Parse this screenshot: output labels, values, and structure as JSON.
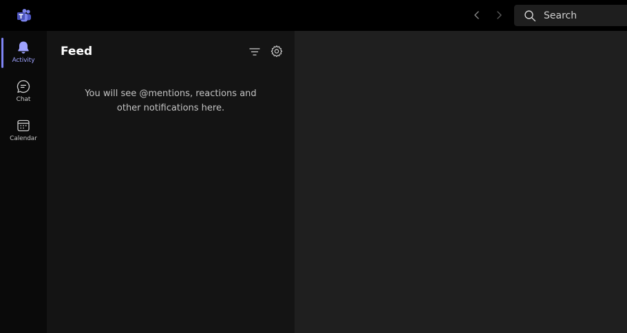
{
  "titlebar": {
    "search": {
      "placeholder": "Search"
    }
  },
  "rail": {
    "items": [
      {
        "label": "Activity",
        "icon": "bell-icon",
        "active": true
      },
      {
        "label": "Chat",
        "icon": "chat-icon",
        "active": false
      },
      {
        "label": "Calendar",
        "icon": "calendar-icon",
        "active": false
      }
    ]
  },
  "feed": {
    "title": "Feed",
    "empty_message": "You will see @mentions, reactions and other notifications here."
  },
  "colors": {
    "accent": "#7f85f5",
    "titlebar_bg": "#000000",
    "rail_bg": "#0a0a0a",
    "feed_bg": "#141414",
    "main_bg": "#1f1f1f"
  }
}
